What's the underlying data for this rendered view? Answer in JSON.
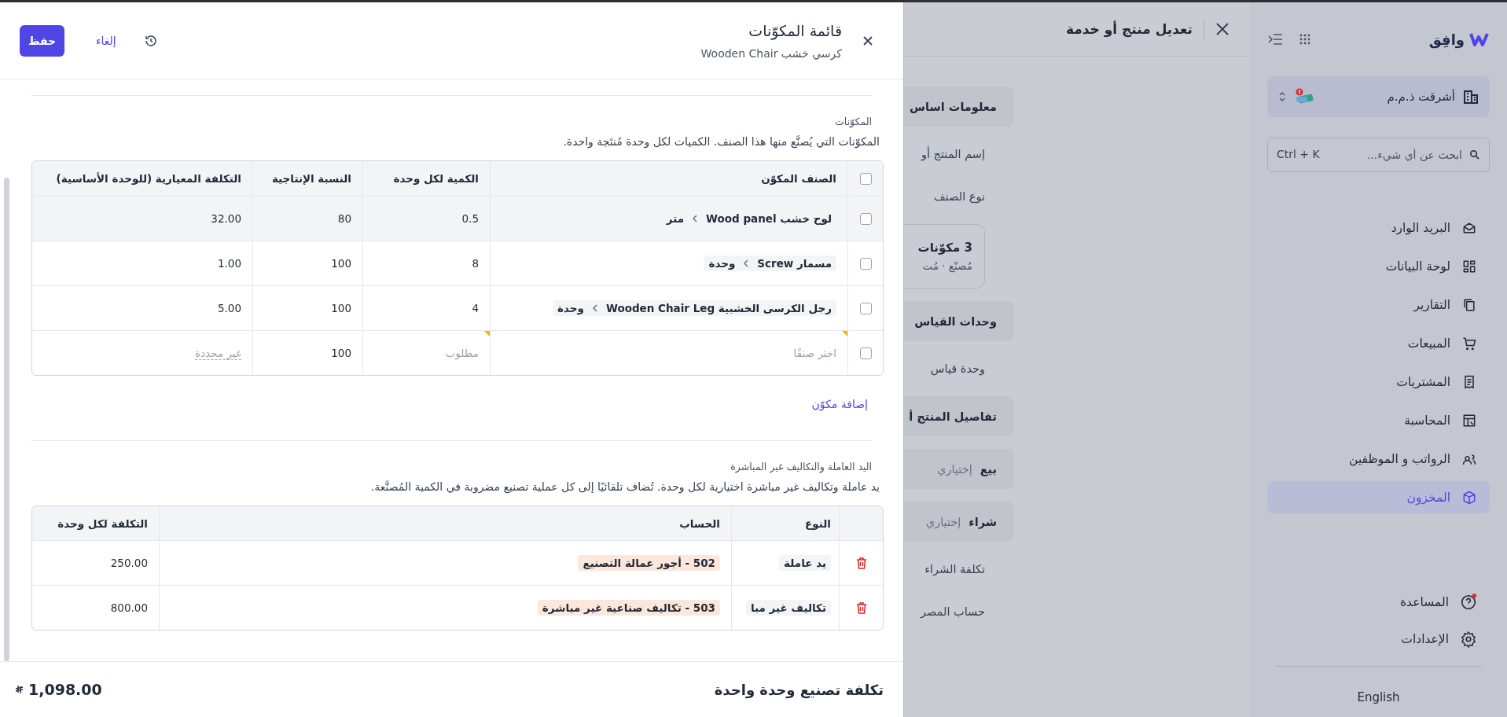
{
  "sidebar": {
    "logo_text": "وافِق",
    "company": "أشرقت ذ.م.م",
    "search": {
      "placeholder": "ابحث عن أي شيء...",
      "shortcut": "Ctrl + K"
    },
    "nav": [
      {
        "label": "البريد الوارد",
        "selected": false
      },
      {
        "label": "لوحة البيانات",
        "selected": false
      },
      {
        "label": "التقارير",
        "selected": false
      },
      {
        "label": "المبيعات",
        "selected": false
      },
      {
        "label": "المشتريات",
        "selected": false
      },
      {
        "label": "المحاسبة",
        "selected": false
      },
      {
        "label": "الرواتب و الموظفين",
        "selected": false
      },
      {
        "label": "المخزون",
        "selected": true
      }
    ],
    "bottom": [
      {
        "label": "المساعدة",
        "badge": true
      },
      {
        "label": "الإعدادات",
        "badge": false
      }
    ],
    "language": "English"
  },
  "edit_panel": {
    "title": "تعديل منتج أو خدمة",
    "items": [
      {
        "kind": "section",
        "label": "معلومات اساس"
      },
      {
        "kind": "field",
        "label": "إسم المنتج أو"
      },
      {
        "kind": "field",
        "label": "نوع الصنف"
      },
      {
        "kind": "card",
        "title": "3 مكوّنات",
        "subtitle": "مُصنّع · مُت"
      },
      {
        "kind": "section",
        "label": "وحدات القياس"
      },
      {
        "kind": "field",
        "label": "وحدة قياس"
      },
      {
        "kind": "section",
        "label": "تفاصيل المنتج أ"
      },
      {
        "kind": "option",
        "label": "بيع",
        "value": "إختياري"
      },
      {
        "kind": "option",
        "label": "شراء",
        "value": "إختياري"
      },
      {
        "kind": "field",
        "label": "تكلفة الشراء"
      },
      {
        "kind": "field",
        "label": "حساب المصر"
      }
    ]
  },
  "drawer": {
    "title": "قائمة المكوّنات",
    "subtitle": "كرسي خشب Wooden Chair",
    "save": "حفظ",
    "cancel": "إلغاء",
    "components": {
      "heading": "المكوّنات",
      "description": "المكوّنات التي يُصنَّع منها هذا الصنف. الكميات لكل وحدة مُنتَجة واحدة.",
      "header_checked": false,
      "columns": [
        "الصنف المكوّن",
        "الكمية لكل وحدة",
        "النسبة الإنتاجية",
        "التكلفة المعيارية (للوحدة الأساسية)"
      ],
      "rows": [
        {
          "kind": "item",
          "checked": false,
          "highlighted": true,
          "item_path": [
            "لوح خشب Wood panel",
            "متر"
          ],
          "quantity": "0.5",
          "ratio": "80",
          "cost": "32.00"
        },
        {
          "kind": "item",
          "checked": false,
          "highlighted": false,
          "item_path": [
            "مسمار Screw",
            "وحدة"
          ],
          "quantity": "8",
          "ratio": "100",
          "cost": "1.00"
        },
        {
          "kind": "item",
          "checked": false,
          "highlighted": false,
          "item_path": [
            "رجل الكرسى الخشبية Wooden Chair Leg",
            "وحدة"
          ],
          "quantity": "4",
          "ratio": "100",
          "cost": "5.00"
        },
        {
          "kind": "new",
          "checked": false,
          "highlighted": false,
          "required": true,
          "item_placeholder": "اختر صنفًا",
          "quantity_placeholder": "مطلوب",
          "ratio": "100",
          "cost": "غير محددة"
        }
      ],
      "add_link": "إضافة مكوّن"
    },
    "labor": {
      "heading": "اليد العاملة والتكاليف غير المباشرة",
      "description": "يد عاملة وتكاليف غير مباشرة اختيارية لكل وحدة. تُضاف تلقائيًا إلى كل عملية تصنيع مضروبة في الكمية المُصنَّعة.",
      "columns": [
        "النوع",
        "الحساب",
        "التكلفة لكل وحدة"
      ],
      "rows": [
        {
          "type": "يد عاملة",
          "account": "502 - أجور عمالة التصنيع",
          "cost": "250.00"
        },
        {
          "type": "تكاليف غير مبا",
          "account": "503 - تكاليف صناعية غير مباشرة",
          "cost": "800.00"
        }
      ]
    },
    "total_label": "تكلفة تصنيع وحدة واحدة",
    "total": "1,098.00"
  }
}
